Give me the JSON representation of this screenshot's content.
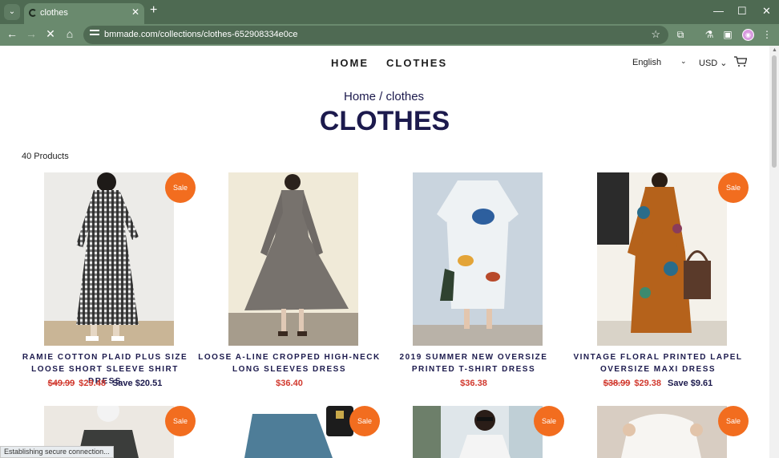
{
  "browser": {
    "tab_title": "clothes",
    "url": "bmmade.com/collections/clothes-652908334e0ce",
    "status_text": "Establishing secure connection..."
  },
  "nav": {
    "home": "HOME",
    "clothes": "CLOTHES",
    "language": "English",
    "currency": "USD"
  },
  "breadcrumb": "Home  /  clothes",
  "title": "CLOTHES",
  "product_count": "40 Products",
  "sale_badge": "Sale",
  "products": [
    {
      "name": "RAMIE COTTON PLAID PLUS SIZE LOOSE SHORT SLEEVE SHIRT DRESS",
      "old_price": "$49.99",
      "price": "$29.48",
      "save": "Save $20.51"
    },
    {
      "name": "LOOSE A-LINE CROPPED HIGH-NECK LONG SLEEVES DRESS",
      "old_price": "",
      "price": "$36.40",
      "save": ""
    },
    {
      "name": "2019 SUMMER NEW OVERSIZE PRINTED T-SHIRT DRESS",
      "old_price": "",
      "price": "$36.38",
      "save": ""
    },
    {
      "name": "VINTAGE FLORAL PRINTED LAPEL OVERSIZE MAXI DRESS",
      "old_price": "$38.99",
      "price": "$29.38",
      "save": "Save $9.61"
    }
  ],
  "colors": {
    "chrome": "#4e6a52",
    "accent": "#f26d1f",
    "heading": "#1c1a4d",
    "price": "#d1382d"
  }
}
